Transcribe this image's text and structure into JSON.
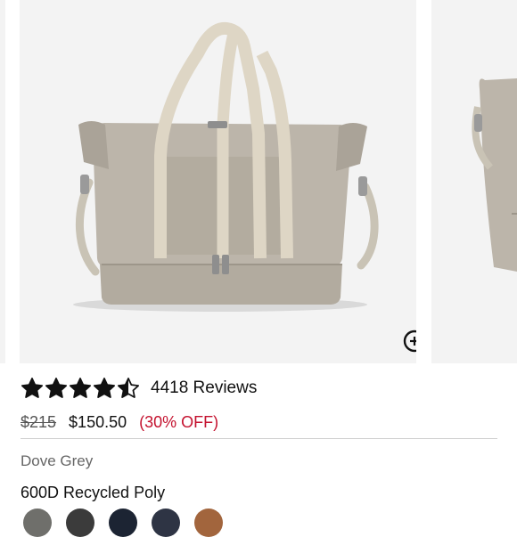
{
  "product": {
    "image_alt": "Weekender duffel bag in Dove Grey",
    "rating": 4.5,
    "rating_max": 5,
    "reviews_label": "4418 Reviews",
    "price_original": "$215",
    "price_sale": "$150.50",
    "price_discount": "(30% OFF)",
    "color_name": "Dove Grey",
    "material_name": "600D Recycled Poly"
  },
  "icons": {
    "zoom": "zoom-in-icon",
    "star_full": "star-filled-icon",
    "star_half": "star-half-icon"
  },
  "swatches": [
    {
      "name": "swatch-1",
      "color": "#6f6f6b"
    },
    {
      "name": "swatch-2",
      "color": "#3b3b3b"
    },
    {
      "name": "swatch-3",
      "color": "#1c2433"
    },
    {
      "name": "swatch-4",
      "color": "#2e3444"
    },
    {
      "name": "swatch-5",
      "color": "#a2653d"
    }
  ],
  "colors": {
    "discount": "#c4122f",
    "divider": "#cfcfcf",
    "image_bg": "#f3f3f3"
  }
}
